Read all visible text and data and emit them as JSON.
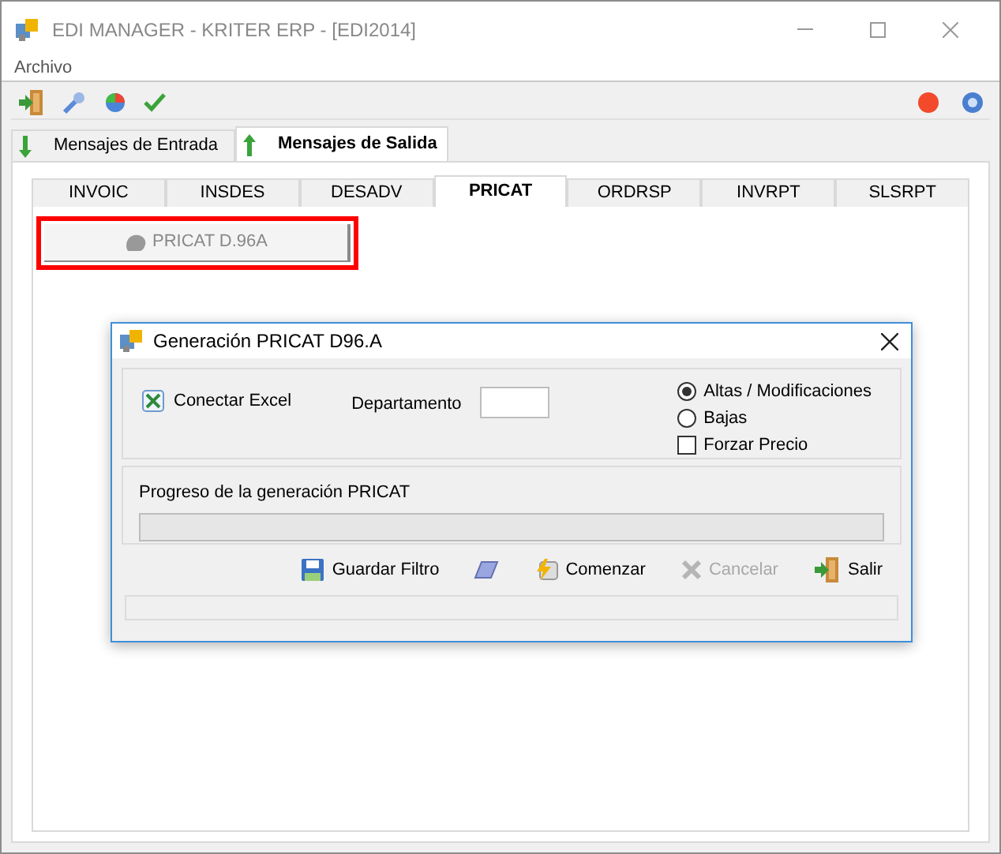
{
  "window": {
    "title": "EDI MANAGER - KRITER ERP - [EDI2014]"
  },
  "menu": [
    "Archivo"
  ],
  "outer_tabs": [
    {
      "label": "Mensajes de Entrada",
      "selected": false,
      "kind": "down"
    },
    {
      "label": "Mensajes de Salida",
      "selected": true,
      "kind": "up"
    }
  ],
  "inner_tabs": [
    {
      "label": "INVOIC",
      "selected": false
    },
    {
      "label": "INSDES",
      "selected": false
    },
    {
      "label": "DESADV",
      "selected": false
    },
    {
      "label": "PRICAT",
      "selected": true
    },
    {
      "label": "ORDRSP",
      "selected": false
    },
    {
      "label": "INVRPT",
      "selected": false
    },
    {
      "label": "SLSRPT",
      "selected": false
    }
  ],
  "pricat_button": {
    "label": "PRICAT D.96A",
    "highlighted": true
  },
  "dialog": {
    "title": "Generación PRICAT D96.A",
    "connect_excel": "Conectar Excel",
    "department_label": "Departamento",
    "options": [
      {
        "kind": "radio",
        "label": "Altas / Modificaciones",
        "checked": true
      },
      {
        "kind": "radio",
        "label": "Bajas",
        "checked": false
      },
      {
        "kind": "checkbox",
        "label": "Forzar Precio",
        "checked": false
      }
    ],
    "progress_label": "Progreso de la generación PRICAT",
    "progress": {
      "level": 0
    },
    "buttons": [
      {
        "kind": "save",
        "label": "Guardar Filtro",
        "disabled": false
      },
      {
        "kind": "eraser",
        "disabled": false
      },
      {
        "kind": "start",
        "label": "Comenzar",
        "disabled": false
      },
      {
        "kind": "cancel",
        "label": "Cancelar",
        "disabled": true
      },
      {
        "kind": "exit",
        "label": "Salir",
        "disabled": false
      }
    ]
  }
}
